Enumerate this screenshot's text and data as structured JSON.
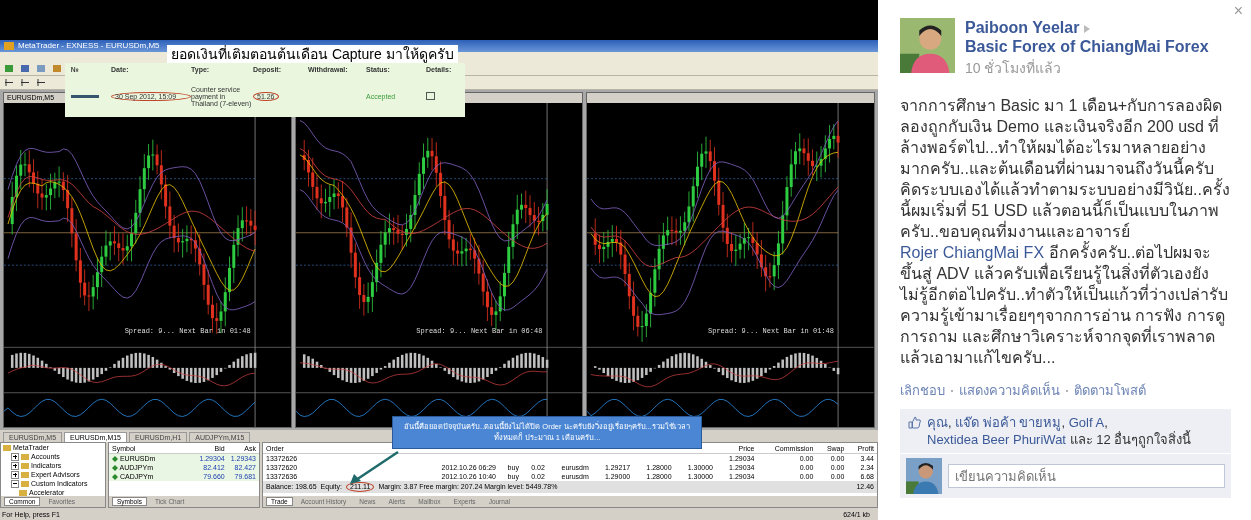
{
  "photo": {
    "window_title": "MetaTrader - EXNESS - EURUSDm,M5",
    "caption": "ยอดเงินที่เติมตอนต้นเดือน Capture มาให้ดูครับ",
    "deposit": {
      "columns": [
        "№",
        "Date:",
        "Type:",
        "Deposit:",
        "Withdrawal:",
        "Status:",
        "Details:"
      ],
      "date": "30 Sep 2012, 15:09",
      "type": "Counter service payment in Thailand (7-eleven)",
      "amount": "51.26",
      "status": "Accepted"
    },
    "charts": [
      {
        "title": "EURUSDm,M5",
        "footer": "Spread: 9... Next Bar in 01:48"
      },
      {
        "footer": "Spread: 9... Next Bar in 06:48"
      },
      {
        "footer": "Spread: 9... Next Bar in 01:48"
      }
    ],
    "chart_tabs": [
      {
        "label": "EURUSDm,M5",
        "selected": false
      },
      {
        "label": "EURUSDm,M15",
        "selected": true
      },
      {
        "label": "EURUSDm,H1",
        "selected": false
      },
      {
        "label": "AUDJPYm,M15",
        "selected": false
      }
    ],
    "navigator": {
      "label": "MetaTrader",
      "children": [
        {
          "label": "Accounts",
          "expanded": false
        },
        {
          "label": "Indicators",
          "expanded": false
        },
        {
          "label": "Expert Advisors",
          "expanded": false
        },
        {
          "label": "Custom Indicators",
          "expanded": true,
          "children": [
            {
              "label": "Accelerator"
            }
          ]
        }
      ]
    },
    "navigator_tabs": [
      {
        "label": "Common",
        "selected": true
      },
      {
        "label": "Favorites",
        "selected": false
      }
    ],
    "market_watch": {
      "columns": [
        "Symbol",
        "Bid",
        "Ask"
      ],
      "rows": [
        [
          "EURUSDm",
          "1.29304",
          "1.29343"
        ],
        [
          "AUDJPYm",
          "82.412",
          "82.427"
        ],
        [
          "CADJPYm",
          "79.660",
          "79.681"
        ]
      ],
      "tabs": [
        {
          "label": "Symbols",
          "selected": true
        },
        {
          "label": "Tick Chart",
          "selected": false
        }
      ]
    },
    "trade": {
      "columns": {
        "order": "Order",
        "price": "Price",
        "commission": "Commission",
        "swap": "Swap",
        "profit": "Profit"
      },
      "rows": [
        {
          "order": "13372626",
          "price": "1.29034",
          "commission": "0.00",
          "swap": "0.00",
          "profit": "3.44"
        },
        {
          "order": "13372620",
          "time": "2012.10.26 06:29",
          "type": "buy",
          "size": "0.02",
          "symbol": "eurusdm",
          "open_price": "1.29217",
          "sl": "1.28000",
          "tp": "1.30000",
          "price": "1.29034",
          "commission": "0.00",
          "swap": "0.00",
          "profit": "2.34"
        },
        {
          "order": "13372636",
          "time": "2012.10.26 10:40",
          "type": "buy",
          "size": "0.02",
          "symbol": "eurusdm",
          "open_price": "1.29000",
          "sl": "1.28000",
          "tp": "1.30000",
          "price": "1.29034",
          "commission": "0.00",
          "swap": "0.00",
          "profit": "6.68"
        }
      ],
      "balance": "Balance: 198.65",
      "equity_label": "Equity:",
      "equity": "211.11",
      "margins": "Margin: 3.87 Free margin: 207.24 Margin level: 5449.78%",
      "total_profit": "12.46",
      "tabs": [
        {
          "label": "Trade",
          "selected": true
        },
        {
          "label": "Account History",
          "selected": false
        },
        {
          "label": "News",
          "selected": false
        },
        {
          "label": "Alerts",
          "selected": false
        },
        {
          "label": "Mailbox",
          "selected": false
        },
        {
          "label": "Experts",
          "selected": false
        },
        {
          "label": "Journal",
          "selected": false
        }
      ]
    },
    "note": "อันนี้คือยอดปัจจุบันครับ..ตอนนี้ยังไม่ได้ปิด Order นะครับยังวิ่งอยู่เรื่อยๆครับ...รวมใช้เวลาทั้งหมดก็ ประมาณ 1 เดือนครับ...",
    "status_left": "For Help, press F1",
    "status_right": "624/1 kb"
  },
  "post": {
    "close": "×",
    "author": "Paiboon Yeelar",
    "group": "Basic Forex of ChiangMai Forex",
    "time": "10 ชั่วโมงที่แล้ว",
    "body_before": "จากการศึกษา Basic มา 1 เดือน+กับการลองผิดลองถูกกับเงิน Demo และเงินจริงอีก 200 usd ที่ล้างพอร์ตไป...ทำให้ผมได้อะไรมาหลายอย่างมากครับ..และต้นเดือนที่ผ่านมาจนถึงวันนี้ครับคิดระบบเองได้แล้วทำตามระบบอย่างมีวินัย..ครั้งนี้ผมเริ่มที่ 51 USD แล้วตอนนี้ก็เป็นแบบในภาพครับ..ขอบคุณที่มงานและอาจารย์",
    "body_link": "Rojer ChiangMai FX",
    "body_after": "อีกครั้งครับ..ต่อไปผมจะขึ้นสู่ ADV แล้วครับเพื่อเรียนรู้ในสิ่งที่ตัวเองยังไม่รู้อีกต่อไปครับ..ทำตัวให้เป็นแก้วที่ว่างเปล่ารับความรู้เข้ามาเรื่อยๆๆจากการอ่าน การฟัง การดู การถาม และศึกษาวิเคราะห์จากจุดที่เราพลาดแล้วเอามาแก้ไขครับ...",
    "actions": [
      "เลิกชอบ",
      "แสดงความคิดเห็น",
      "ติดตามโพสต์"
    ],
    "likers": [
      {
        "name": "คุณ",
        "after": ","
      },
      {
        "name": "แจ๊ด พ่อค้า ขายหมู",
        "after": ","
      },
      {
        "name": "Golf A",
        "after": ","
      },
      {
        "name": "Nextidea Beer PhuriWat"
      }
    ],
    "likes_rest": "และ 12 อื่นๆถูกใจสิ่งนี้",
    "comment": {
      "placeholder": "เขียนความคิดเห็น"
    }
  }
}
